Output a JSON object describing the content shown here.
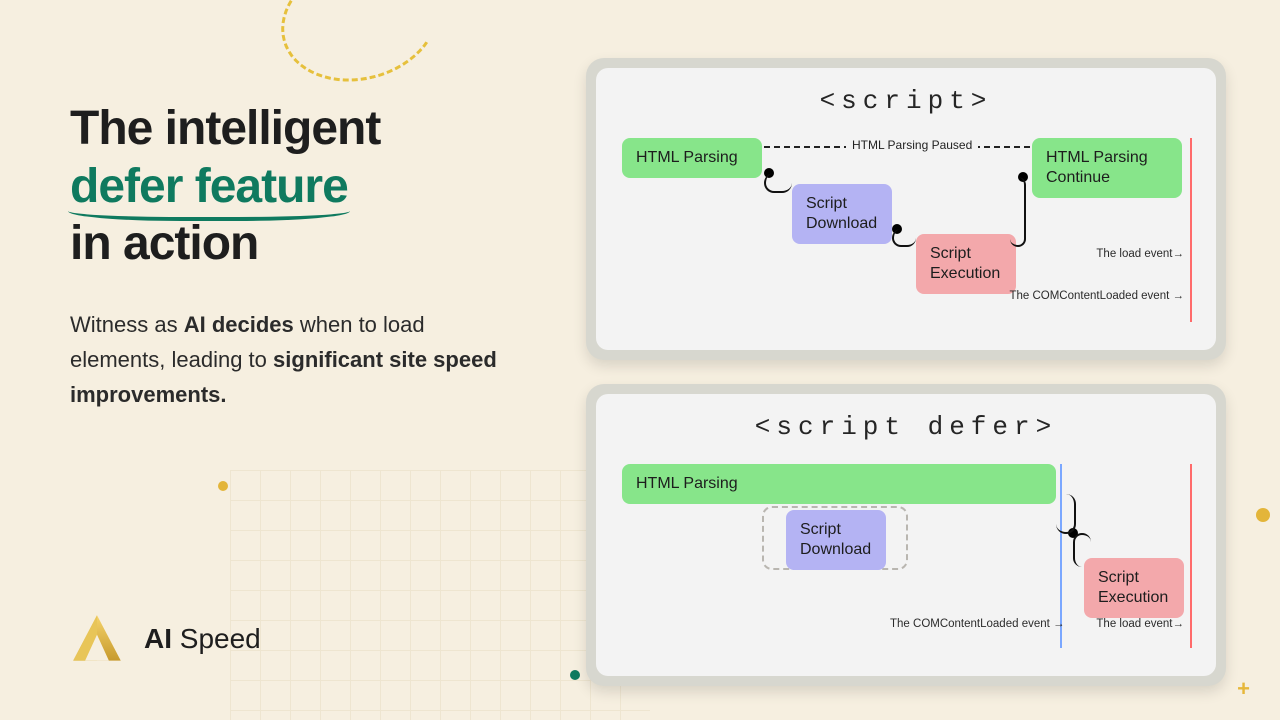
{
  "headline": {
    "line1": "The intelligent",
    "accent": "defer feature",
    "line3": "in action"
  },
  "sub": {
    "pre": "Witness as ",
    "b1": "AI decides",
    "mid": " when to load elements, leading to ",
    "b2": "significant site speed improvements."
  },
  "brand": {
    "name_bold": "AI",
    "name_rest": " Speed"
  },
  "card_script": {
    "title": "<script>",
    "blocks": {
      "html_parsing": "HTML Parsing",
      "script_download": "Script\nDownload",
      "script_execution": "Script\nExecution",
      "html_continue": "HTML Parsing\nContinue"
    },
    "paused_label": "HTML Parsing Paused",
    "event_dom": "The COMContentLoaded event  →",
    "event_load": "The load event→"
  },
  "card_defer": {
    "title": "<script defer>",
    "blocks": {
      "html_parsing": "HTML Parsing",
      "script_download": "Script\nDownload",
      "script_execution": "Script\nExecution"
    },
    "event_dom": "The COMContentLoaded event  →",
    "event_load": "The load event→"
  }
}
